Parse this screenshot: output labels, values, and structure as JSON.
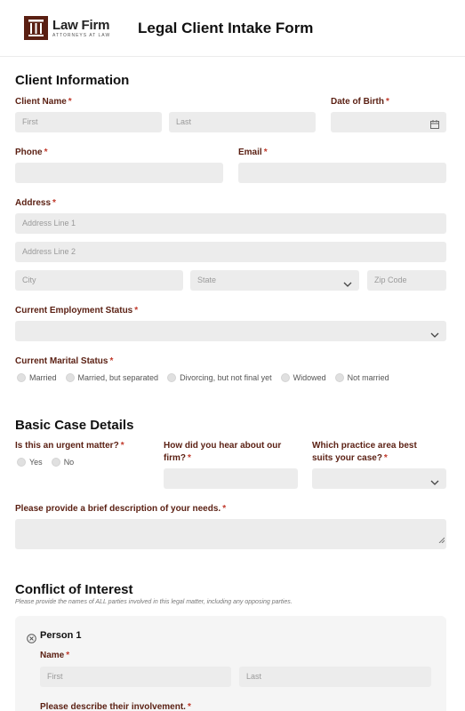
{
  "header": {
    "logo_name": "Law Firm",
    "logo_sub": "ATTORNEYS AT LAW",
    "title": "Legal Client Intake Form",
    "brand_color": "#5a1f12"
  },
  "required_mark": "*",
  "client_info": {
    "title": "Client Information",
    "client_name_label": "Client Name",
    "first_ph": "First",
    "last_ph": "Last",
    "dob_label": "Date of Birth",
    "phone_label": "Phone",
    "email_label": "Email",
    "address_label": "Address",
    "address1_ph": "Address Line 1",
    "address2_ph": "Address Line 2",
    "city_ph": "City",
    "state_ph": "State",
    "zip_ph": "Zip Code",
    "employment_label": "Current Employment Status",
    "marital_label": "Current Marital Status",
    "marital_options": [
      "Married",
      "Married, but separated",
      "Divorcing, but not final yet",
      "Widowed",
      "Not married"
    ]
  },
  "case_details": {
    "title": "Basic Case Details",
    "urgent_label": "Is this an urgent matter?",
    "urgent_options": [
      "Yes",
      "No"
    ],
    "hear_label_1": "How did you hear about our",
    "hear_label_2": "firm?",
    "practice_label_1": "Which practice area best",
    "practice_label_2": "suits your case?",
    "description_label": "Please provide a brief description of your needs."
  },
  "conflict": {
    "title": "Conflict of Interest",
    "note": "Please provide the names of ALL parties involved in this legal matter, including any opposing parties.",
    "person_title": "Person 1",
    "name_label": "Name",
    "first_ph": "First",
    "last_ph": "Last",
    "involvement_label": "Please describe their involvement."
  }
}
